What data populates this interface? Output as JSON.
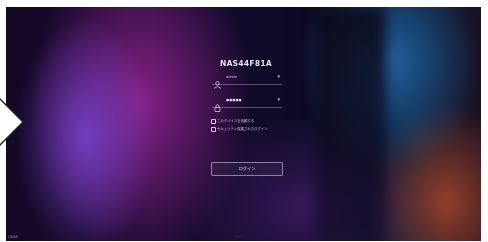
{
  "login": {
    "hostname": "NAS44F81A",
    "username_value": "admin",
    "password_value": "●●●●●",
    "remember_label": "このデバイスを信頼する",
    "secure_label": "セキュリティ保護されたログイン",
    "login_button": "ログイン"
  },
  "footer": {
    "left_text": "QNAP",
    "center_text": "· · ·"
  },
  "icons": {
    "user": "user-icon",
    "lock": "lock-icon",
    "arrow": "arrow-right-icon"
  }
}
